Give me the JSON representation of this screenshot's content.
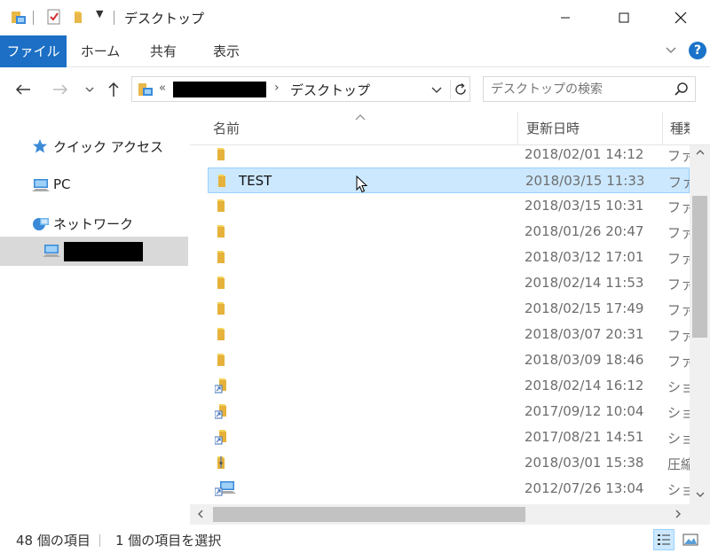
{
  "window": {
    "title": "デスクトップ"
  },
  "ribbon": {
    "tabs": [
      "ファイル",
      "ホーム",
      "共有",
      "表示"
    ],
    "help": "?"
  },
  "address": {
    "separator": "«",
    "current": "デスクトップ"
  },
  "search": {
    "placeholder": "デスクトップの検索"
  },
  "nav": {
    "quick_access": "クイック アクセス",
    "pc": "PC",
    "network": "ネットワーク"
  },
  "columns": {
    "name": "名前",
    "modified": "更新日時",
    "type": "種類"
  },
  "files": [
    {
      "name": "",
      "date": "2018/02/01 14:12",
      "type": "ファイル フォルダー",
      "icon": "folder-icon"
    },
    {
      "name": "TEST",
      "date": "2018/03/15 11:33",
      "type": "ファイル フォルダー",
      "icon": "folder-icon",
      "selected": true
    },
    {
      "name": "",
      "date": "2018/03/15 10:31",
      "type": "ファイル フォルダー",
      "icon": "folder-icon"
    },
    {
      "name": "",
      "date": "2018/01/26 20:47",
      "type": "ファイル フォルダー",
      "icon": "folder-icon"
    },
    {
      "name": "",
      "date": "2018/03/12 17:01",
      "type": "ファイル フォルダー",
      "icon": "folder-icon"
    },
    {
      "name": "",
      "date": "2018/02/14 11:53",
      "type": "ファイル フォルダー",
      "icon": "folder-icon"
    },
    {
      "name": "",
      "date": "2018/02/15 17:49",
      "type": "ファイル フォルダー",
      "icon": "folder-icon"
    },
    {
      "name": "",
      "date": "2018/03/07 20:31",
      "type": "ファイル フォルダー",
      "icon": "folder-icon"
    },
    {
      "name": "",
      "date": "2018/03/09 18:46",
      "type": "ファイル フォルダー",
      "icon": "folder-icon"
    },
    {
      "name": "",
      "date": "2018/02/14 16:12",
      "type": "ショートカット",
      "icon": "shortcut-folder-icon"
    },
    {
      "name": "",
      "date": "2017/09/12 10:04",
      "type": "ショートカット",
      "icon": "shortcut-folder-icon"
    },
    {
      "name": "",
      "date": "2017/08/21 14:51",
      "type": "ショートカット",
      "icon": "shortcut-folder-icon"
    },
    {
      "name": "",
      "date": "2018/03/01 15:38",
      "type": "圧縮",
      "icon": "zip-folder-icon"
    },
    {
      "name": "",
      "date": "2012/07/26 13:04",
      "type": "ショートカット",
      "icon": "shortcut-network-icon"
    }
  ],
  "status": {
    "item_count": "48 個の項目",
    "selected": "1 個の項目を選択"
  }
}
